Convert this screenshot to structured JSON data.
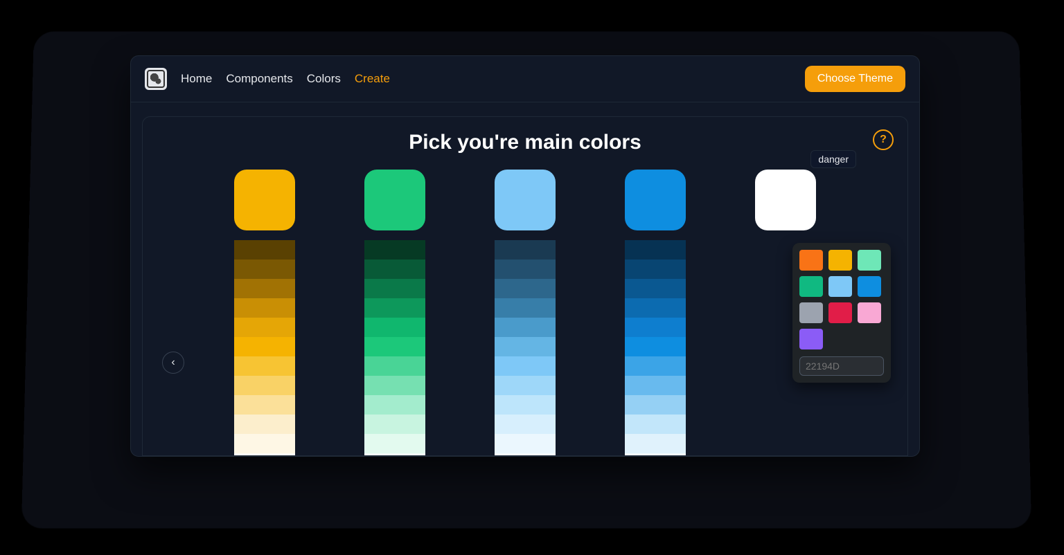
{
  "nav": {
    "items": [
      {
        "label": "Home",
        "active": false
      },
      {
        "label": "Components",
        "active": false
      },
      {
        "label": "Colors",
        "active": false
      },
      {
        "label": "Create",
        "active": true
      }
    ],
    "cta_label": "Choose Theme"
  },
  "page": {
    "heading": "Pick you're main colors",
    "help_label": "?",
    "tooltip": "danger",
    "prev_icon": "‹",
    "next_icon": "›"
  },
  "columns": [
    {
      "name": "amber",
      "swatch": "#f5b301",
      "shades": [
        "#5a4102",
        "#7a5803",
        "#a17204",
        "#c98f05",
        "#e5a606",
        "#f5b301",
        "#f7c433",
        "#f9d266",
        "#fbe099",
        "#fceecc",
        "#fef7e5",
        "#fffdf5"
      ]
    },
    {
      "name": "green",
      "swatch": "#1cc87a",
      "shades": [
        "#063a24",
        "#085a37",
        "#0a7949",
        "#0d985b",
        "#10b76e",
        "#1cc87a",
        "#49d496",
        "#76e0b1",
        "#a3eccd",
        "#c8f4e0",
        "#e3faef",
        "#f3fdf8"
      ]
    },
    {
      "name": "sky",
      "swatch": "#7ec8f7",
      "shades": [
        "#1a3a52",
        "#23506f",
        "#2d678c",
        "#377ea9",
        "#4a9bcb",
        "#64b5e4",
        "#7ec8f7",
        "#9ed7f9",
        "#bde5fb",
        "#d7effd",
        "#ebf7fe",
        "#f6fcff"
      ]
    },
    {
      "name": "blue",
      "swatch": "#0e8ee0",
      "shades": [
        "#063253",
        "#084572",
        "#0a5891",
        "#0c6bb0",
        "#0e7ecf",
        "#0e8ee0",
        "#3ba4e7",
        "#68baee",
        "#95d0f4",
        "#c2e6fa",
        "#e0f2fc",
        "#f2fafe"
      ]
    },
    {
      "name": "danger",
      "swatch": "#ffffff",
      "shades": []
    }
  ],
  "picker": {
    "colors": [
      "#f97316",
      "#f5b301",
      "#6ee7b7",
      "#10b981",
      "#7ec8f7",
      "#0e8ee0",
      "#9ca3af",
      "#e11d48",
      "#f9a8d4",
      "#8b5cf6"
    ],
    "placeholder": "22194D"
  }
}
